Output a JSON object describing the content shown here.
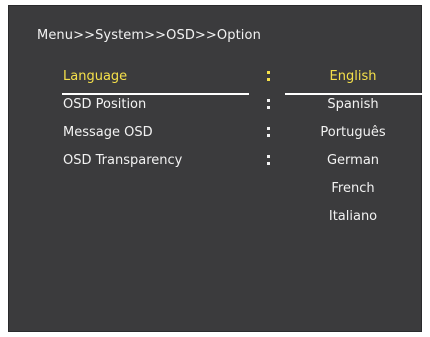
{
  "osd": {
    "breadcrumb": "Menu>>System>>OSD>>Option",
    "options": [
      {
        "label": "Language"
      },
      {
        "label": "OSD Position"
      },
      {
        "label": "Message OSD"
      },
      {
        "label": "OSD Transparency"
      }
    ],
    "selected_option": "Language",
    "values": [
      {
        "label": "English"
      },
      {
        "label": "Spanish"
      },
      {
        "label": "Português"
      },
      {
        "label": "German"
      },
      {
        "label": "French"
      },
      {
        "label": "Italiano"
      }
    ],
    "selected_value": "English"
  },
  "colors": {
    "background": "#3b3b3d",
    "text": "#f2f2f2",
    "highlight": "#f5e04a",
    "underline": "#ffffff"
  }
}
